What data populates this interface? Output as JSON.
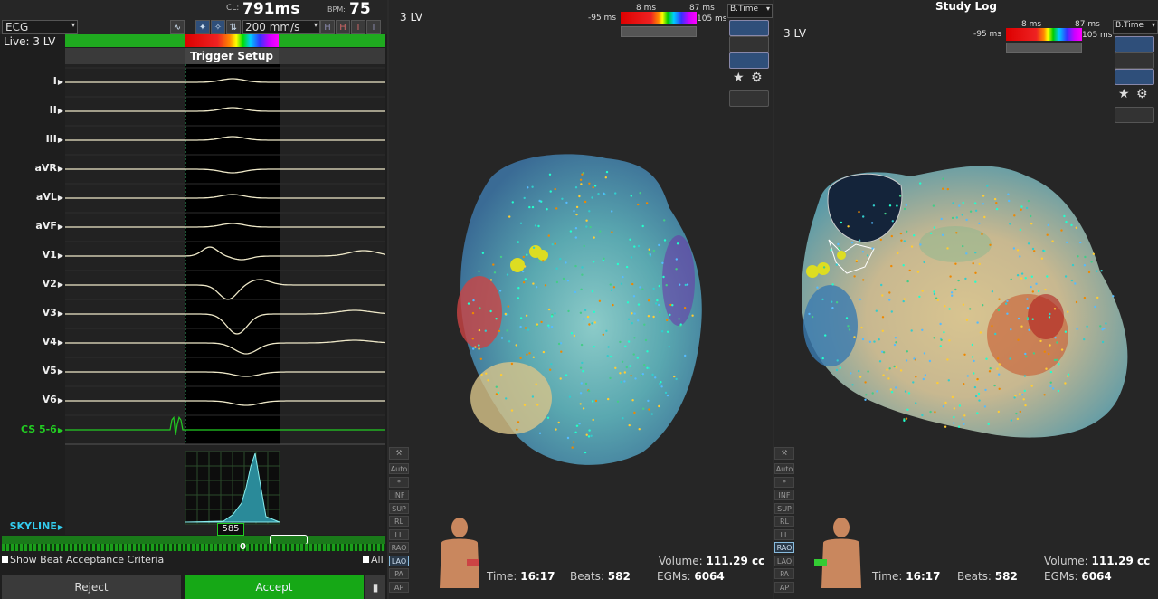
{
  "ecg": {
    "channel_select": "ECG",
    "cl_label": "CL:",
    "cl_value": "791ms",
    "bpm_label": "BPM:",
    "bpm_value": "75",
    "live_label": "Live: 3 LV",
    "speed": "200 mm/s",
    "trigger_title": "Trigger Setup",
    "leads": [
      "I",
      "II",
      "III",
      "aVR",
      "aVL",
      "aVF",
      "V1",
      "V2",
      "V3",
      "V4",
      "V5",
      "V6"
    ],
    "cs_label": "CS 5-6",
    "skyline_label": "SKYLINE",
    "skyline_value": "585",
    "beat_marker": "0",
    "v1_tag": "R",
    "v3_tag": "V",
    "show_criteria": "Show Beat Acceptance Criteria",
    "all_label": "All",
    "reject_label": "Reject",
    "accept_label": "Accept",
    "colors": {
      "accent_green": "#1faa1f",
      "cs_green": "#22cc22",
      "skyline_cyan": "#33ccee"
    }
  },
  "map_left": {
    "title": "3 LV",
    "scale_min": "-95 ms",
    "scale_mid": "8 ms",
    "scale_max_top": "87 ms",
    "scale_max": "105 ms",
    "dropdown": "B.Time",
    "view_buttons": [
      "Auto",
      "*",
      "INF",
      "SUP",
      "RL",
      "LL",
      "RAO",
      "LAO",
      "PA",
      "AP"
    ],
    "active_view": "LAO",
    "volume_label": "Volume:",
    "volume_value": "111.29 cc",
    "time_label": "Time:",
    "time_value": "16:17",
    "beats_label": "Beats:",
    "beats_value": "582",
    "egms_label": "EGMs:",
    "egms_value": "6064"
  },
  "map_right": {
    "header": "Study Log",
    "title": "3 LV",
    "scale_min": "-95 ms",
    "scale_mid": "8 ms",
    "scale_max_top": "87 ms",
    "scale_max": "105 ms",
    "dropdown": "B.Time",
    "view_buttons": [
      "Auto",
      "*",
      "INF",
      "SUP",
      "RL",
      "LL",
      "RAO",
      "LAO",
      "PA",
      "AP"
    ],
    "active_view": "RAO",
    "volume_label": "Volume:",
    "volume_value": "111.29 cc",
    "time_label": "Time:",
    "time_value": "16:17",
    "beats_label": "Beats:",
    "beats_value": "582",
    "egms_label": "EGMs:",
    "egms_value": "6064"
  }
}
